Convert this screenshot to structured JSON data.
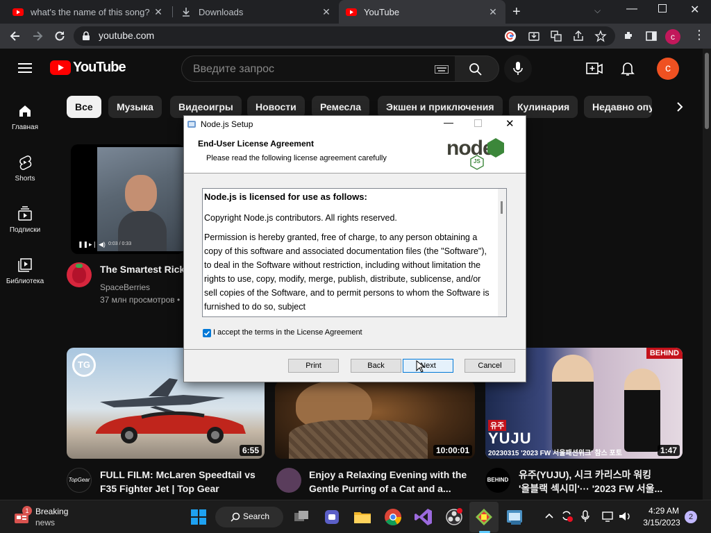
{
  "browser": {
    "tabs": [
      {
        "label": "what's the name of this song? - Y",
        "icon": "youtube-icon"
      },
      {
        "label": "Downloads",
        "icon": "download-icon"
      },
      {
        "label": "YouTube",
        "icon": "youtube-icon"
      }
    ],
    "new_tab_glyph": "+",
    "url": "youtube.com",
    "profile_initial": "c"
  },
  "youtube": {
    "logo_text": "YouTube",
    "search_placeholder": "Введите запрос",
    "avatar_initial": "c",
    "nav": [
      {
        "label": "Главная",
        "icon": "home-icon"
      },
      {
        "label": "Shorts",
        "icon": "shorts-icon"
      },
      {
        "label": "Подписки",
        "icon": "subscriptions-icon"
      },
      {
        "label": "Библиотека",
        "icon": "library-icon"
      }
    ],
    "chips": [
      "Все",
      "Музыка",
      "Видеоигры",
      "Новости",
      "Ремесла",
      "Экшен и приключения",
      "Кулинария",
      "Недавно опу"
    ],
    "videos": [
      {
        "title": "The Smartest RickR",
        "channel": "SpaceBerries",
        "stats": "37 млн просмотров •",
        "player_time": "0:03 / 0:33"
      },
      {
        "title_line1": "FULL FILM: McLaren Speedtail vs",
        "title_line2": "F35 Fighter Jet | Top Gear",
        "duration": "6:55",
        "badge": "TG",
        "channel_avatar": "TopGear"
      },
      {
        "title_line1": "Enjoy a Relaxing Evening with the",
        "title_line2": "Gentle Purring of a Cat and a...",
        "duration": "10:00:01"
      },
      {
        "title_line1": "유주(YUJU), 시크 카리스마 워킹",
        "title_line2": "'올블랙 섹시미'··· '2023 FW 서울...",
        "duration": "1:47",
        "badge": "BEHIND",
        "overlay_name": "YUJU",
        "overlay_kicker": "유주",
        "overlay_caption": "20230315 '2023 FW 서울패션위크' 참스 포토",
        "channel_avatar": "BEHIND"
      }
    ]
  },
  "dialog": {
    "title": "Node.js Setup",
    "heading": "End-User License Agreement",
    "subheading": "Please read the following license agreement carefully",
    "logo_text": "node",
    "logo_sub": "JS",
    "license_title": "Node.js is licensed for use as follows:",
    "license_p1": "Copyright Node.js contributors. All rights reserved.",
    "license_p2": "Permission is hereby granted, free of charge, to any person obtaining a copy of this software and associated documentation files (the \"Software\"), to deal in the Software without restriction, including without limitation the rights to use, copy, modify, merge, publish, distribute, sublicense, and/or sell copies of the Software, and to permit persons to whom the Software is furnished to do so, subject",
    "accept_label": "I accept the terms in the License Agreement",
    "accept_checked": true,
    "buttons": {
      "print": "Print",
      "back": "Back",
      "next": "Next",
      "cancel": "Cancel"
    }
  },
  "taskbar": {
    "news_title": "Breaking",
    "news_sub": "news",
    "news_badge": "1",
    "search_label": "Search",
    "time": "4:29 AM",
    "date": "3/15/2023",
    "notif_count": "2"
  },
  "colors": {
    "yt_red": "#ff0000",
    "avatar_orange": "#ef5121",
    "node_green": "#3c873a",
    "windows_blue": "#0078d7"
  }
}
